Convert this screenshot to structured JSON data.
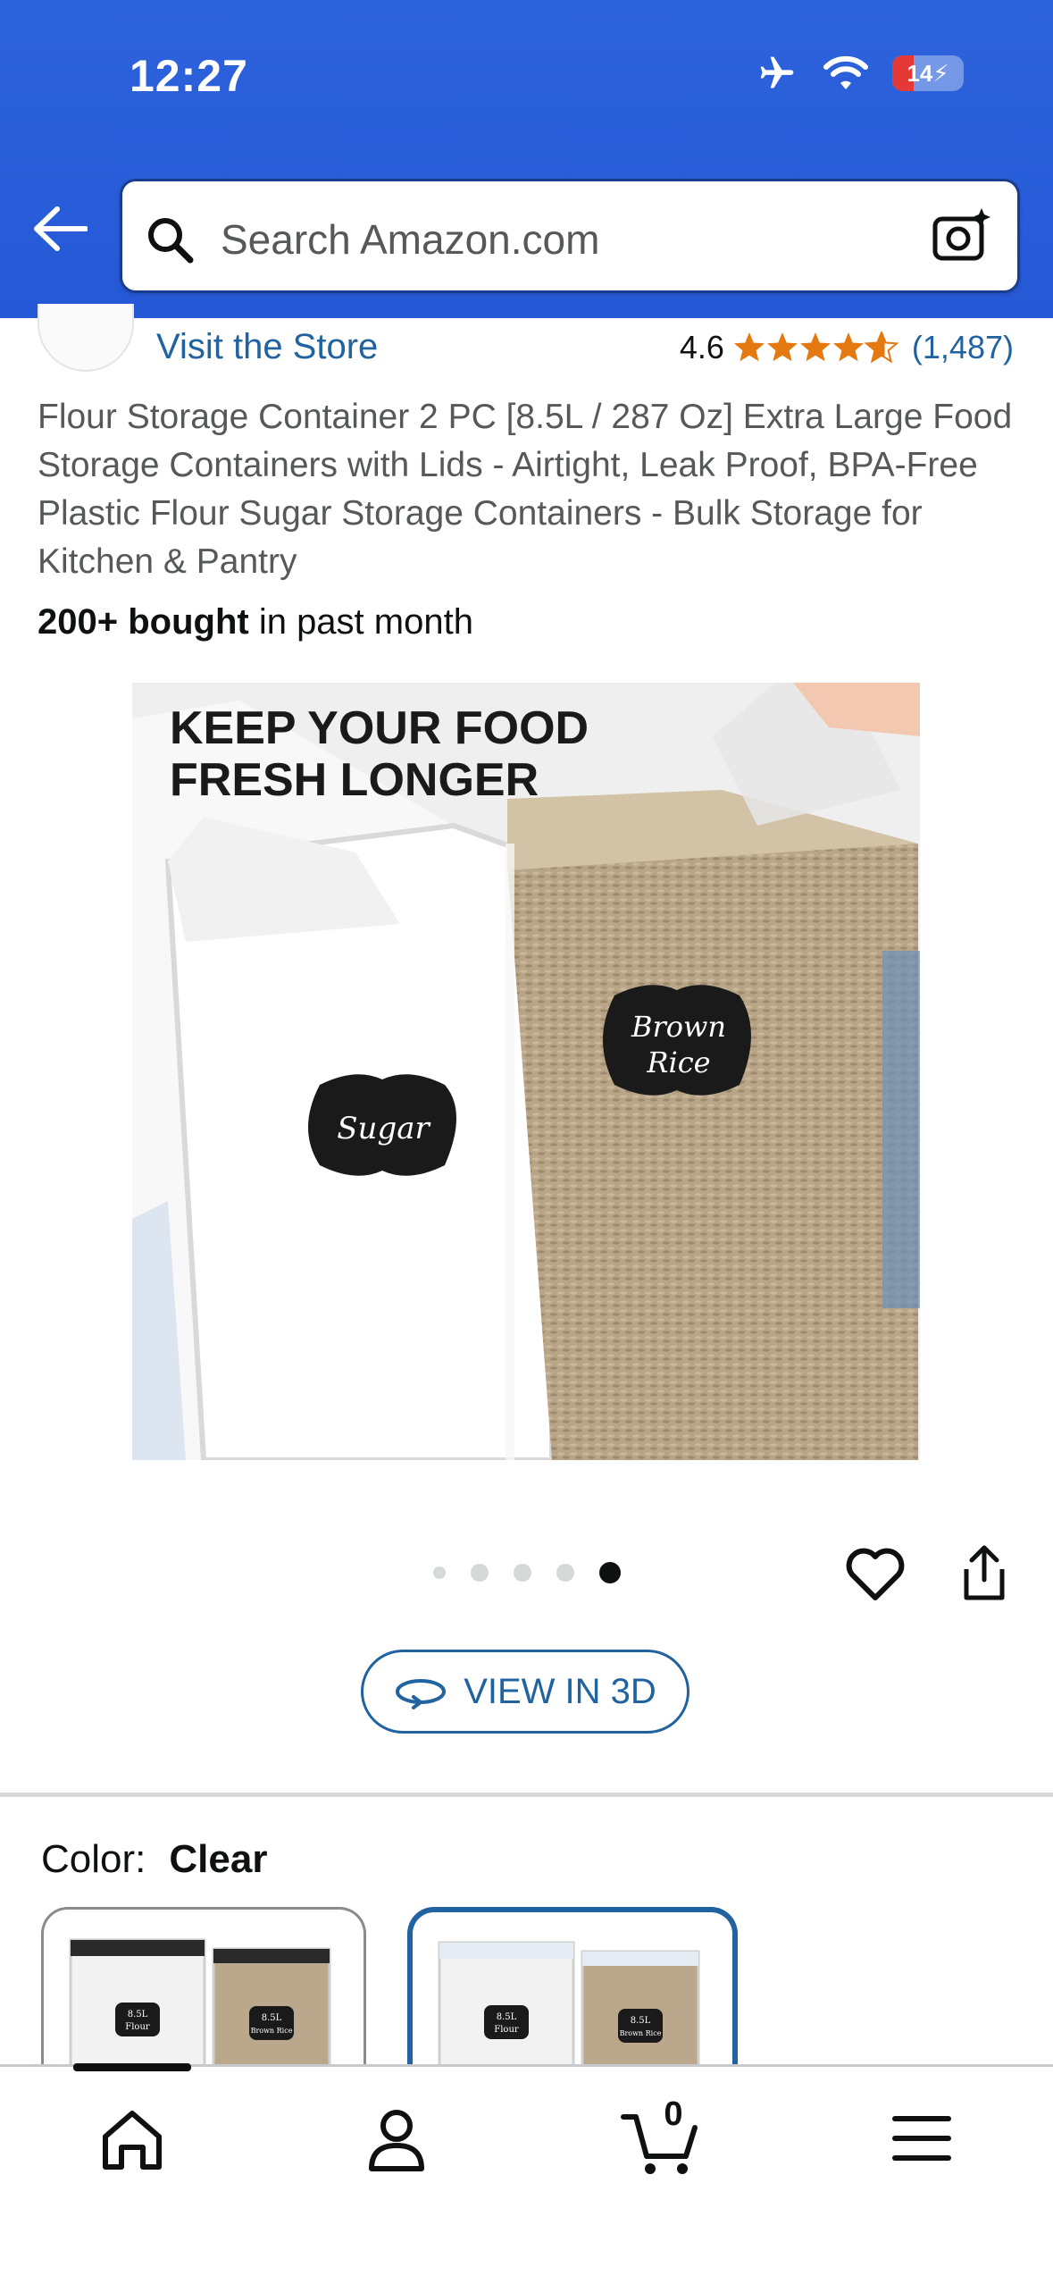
{
  "status_bar": {
    "time": "12:27",
    "battery_level": "14"
  },
  "search": {
    "placeholder": "Search Amazon.com"
  },
  "store": {
    "visit_label": "Visit the Store",
    "rating_value": "4.6",
    "rating_stars": 4.6,
    "rating_count": "(1,487)"
  },
  "product": {
    "title": "Flour Storage Container 2 PC [8.5L / 287 Oz] Extra Large Food Storage Containers with Lids - Airtight, Leak Proof, BPA-Free Plastic Flour Sugar Storage Containers - Bulk Storage for Kitchen & Pantry",
    "bought_bold": "200+ bought",
    "bought_rest": " in past month"
  },
  "image": {
    "headline_line1": "KEEP YOUR FOOD",
    "headline_line2": "FRESH LONGER",
    "label_left": "Sugar",
    "label_right_line1": "Brown",
    "label_right_line2": "Rice"
  },
  "carousel": {
    "total": 5,
    "active_index": 4
  },
  "view3d_label": "VIEW IN 3D",
  "color": {
    "label": "Color:",
    "value": "Clear"
  },
  "swatches": [
    {
      "tag_left_line1": "8.5L",
      "tag_left_line2": "Flour",
      "tag_right_line1": "8.5L",
      "tag_right_line2": "Brown Rice",
      "lid": "dark"
    },
    {
      "tag_left_line1": "8.5L",
      "tag_left_line2": "Flour",
      "tag_right_line1": "8.5L",
      "tag_right_line2": "Brown Rice",
      "lid": "clear"
    }
  ],
  "bottom_nav": {
    "cart_count": "0",
    "items": [
      "home-icon",
      "account-icon",
      "cart-icon",
      "menu-icon"
    ]
  },
  "colors": {
    "header": "#2558d6",
    "link": "#2162a1",
    "star": "#e47911"
  }
}
